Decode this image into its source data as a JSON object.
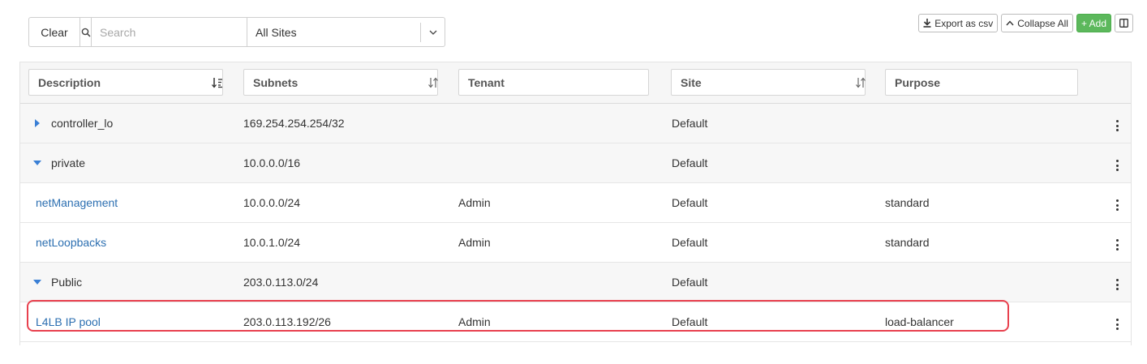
{
  "toolbar": {
    "clear_label": "Clear",
    "search_placeholder": "Search",
    "site_filter_value": "All Sites",
    "export_label": "Export as csv",
    "collapse_label": "Collapse All",
    "add_label": "+ Add"
  },
  "columns": [
    {
      "label": "Description",
      "sort_icon": "sort-alpha-asc-icon"
    },
    {
      "label": "Subnets",
      "sort_icon": "sort-icon"
    },
    {
      "label": "Tenant",
      "sort_icon": ""
    },
    {
      "label": "Site",
      "sort_icon": "sort-icon"
    },
    {
      "label": "Purpose",
      "sort_icon": ""
    }
  ],
  "rows": [
    {
      "type": "group",
      "expanded": false,
      "description": "controller_lo",
      "subnet": "169.254.254.254/32",
      "tenant": "",
      "site": "Default",
      "purpose": ""
    },
    {
      "type": "group",
      "expanded": true,
      "description": "private",
      "subnet": "10.0.0.0/16",
      "tenant": "",
      "site": "Default",
      "purpose": ""
    },
    {
      "type": "item",
      "description": "netManagement",
      "subnet": "10.0.0.0/24",
      "tenant": "Admin",
      "site": "Default",
      "purpose": "standard"
    },
    {
      "type": "item",
      "description": "netLoopbacks",
      "subnet": "10.0.1.0/24",
      "tenant": "Admin",
      "site": "Default",
      "purpose": "standard"
    },
    {
      "type": "group",
      "expanded": true,
      "description": "Public",
      "subnet": "203.0.113.0/24",
      "tenant": "",
      "site": "Default",
      "purpose": ""
    },
    {
      "type": "item",
      "description": "L4LB IP pool",
      "subnet": "203.0.113.192/26",
      "tenant": "Admin",
      "site": "Default",
      "purpose": "load-balancer"
    }
  ],
  "colors": {
    "link": "#2c6fb1",
    "tree_arrow": "#3a7fd5",
    "add_button": "#5cb85c",
    "highlight": "#e8414e"
  }
}
